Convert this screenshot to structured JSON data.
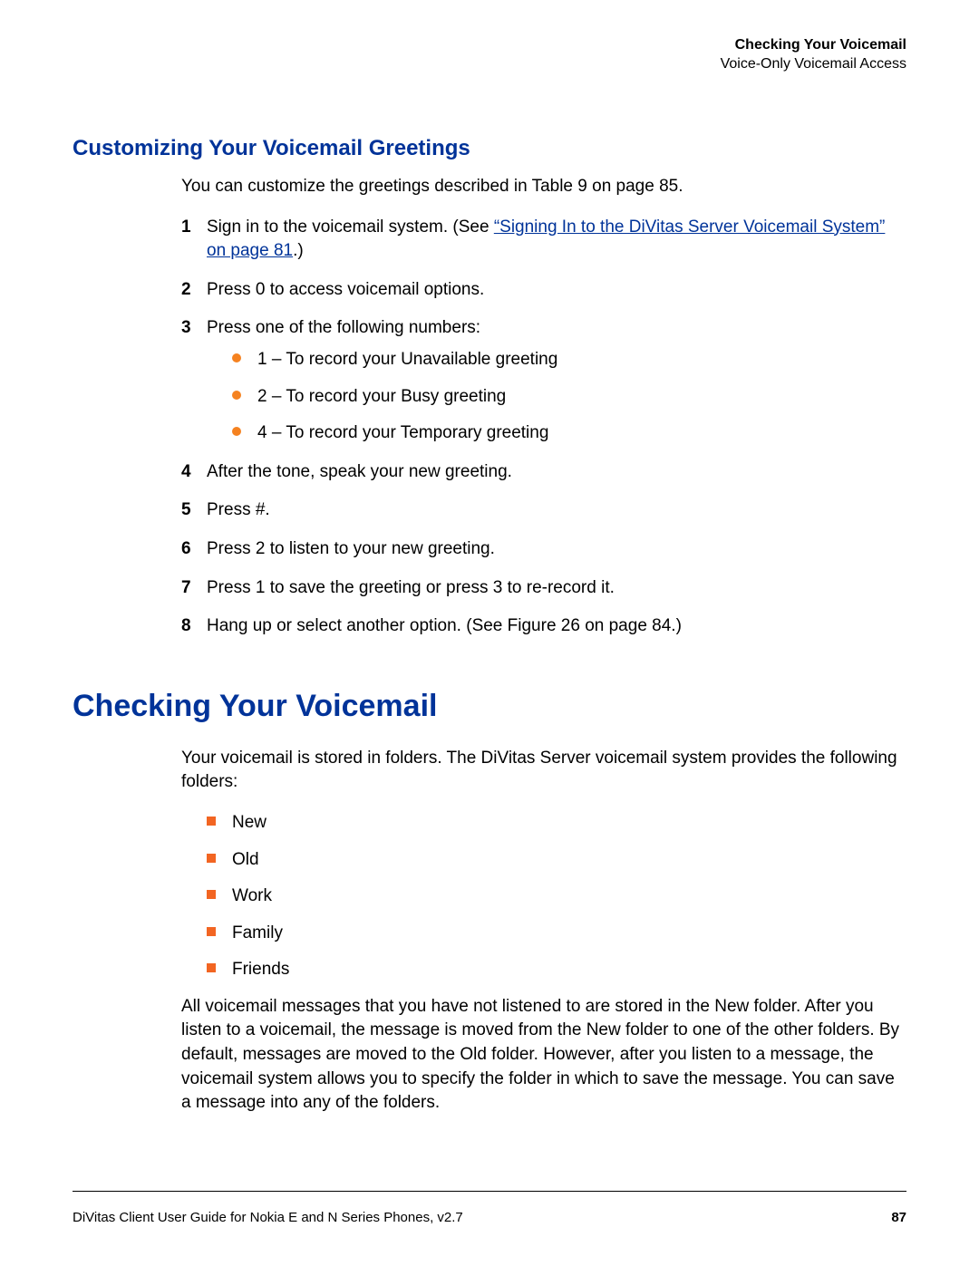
{
  "header": {
    "title_bold": "Checking Your Voicemail",
    "subtitle": "Voice-Only Voicemail Access"
  },
  "section1": {
    "heading": "Customizing Your Voicemail Greetings",
    "intro": "You can customize the greetings described in Table 9 on page 85.",
    "steps": {
      "s1_pre": "Sign in to the voicemail system. (See ",
      "s1_link": "“Signing In to the DiVitas Server Voicemail System” on page 81",
      "s1_post": ".)",
      "s2": "Press 0 to access voicemail options.",
      "s3": "Press one of the following numbers:",
      "s3_bullets": [
        "1 – To record your Unavailable greeting",
        "2 – To record your Busy greeting",
        "4 – To record your Temporary greeting"
      ],
      "s4": "After the tone, speak your new greeting.",
      "s5": "Press #.",
      "s6": "Press 2 to listen to your new greeting.",
      "s7": "Press 1 to save the greeting or press 3 to re-record it.",
      "s8": "Hang up or select another option. (See Figure 26 on page 84.)"
    }
  },
  "section2": {
    "heading": "Checking Your Voicemail",
    "para1": "Your voicemail is stored in folders. The DiVitas Server voicemail system provides the following folders:",
    "folders": [
      "New",
      "Old",
      "Work",
      "Family",
      "Friends"
    ],
    "para2": "All voicemail messages that you have not listened to are stored in the New folder. After you listen to a voicemail, the message is moved from the New folder to one of the other folders. By default, messages are moved to the Old folder. However, after you listen to a message, the voicemail system allows you to specify the folder in which to save the message. You can save a message into any of the folders."
  },
  "footer": {
    "left": "DiVitas Client User Guide for Nokia E and N Series Phones, v2.7",
    "page": "87"
  }
}
